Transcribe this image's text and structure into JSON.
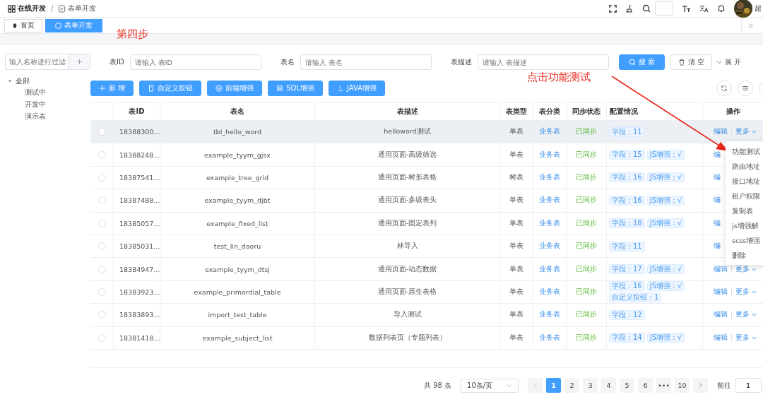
{
  "breadcrumb": [
    {
      "label": "在线开发"
    },
    {
      "label": "表单开发"
    }
  ],
  "breadcrumb_separator": "/",
  "header": {
    "user_name": "超"
  },
  "tabs": [
    {
      "label": "首页",
      "selected": false
    },
    {
      "label": "表单开发",
      "selected": true
    }
  ],
  "annotations": [
    {
      "text": "第四步"
    },
    {
      "text": "点击功能测试"
    }
  ],
  "sidebar": {
    "filter_placeholder": "输入名称进行过滤",
    "tree": [
      {
        "label": "全部",
        "expanded": true,
        "children": [
          {
            "label": "测试中"
          },
          {
            "label": "开发中"
          },
          {
            "label": "演示表"
          }
        ]
      }
    ]
  },
  "search": {
    "fields": [
      {
        "label": "表ID",
        "placeholder": "请输入 表ID"
      },
      {
        "label": "表名",
        "placeholder": "请输入 表名"
      },
      {
        "label": "表描述",
        "placeholder": "请输入 表描述"
      }
    ],
    "search_button": "搜 索",
    "clear_button": "清 空",
    "expand_link": "展 开"
  },
  "toolbar": [
    {
      "kind": "plus",
      "label": "新 增"
    },
    {
      "kind": "custom",
      "label": "自定义按钮"
    },
    {
      "kind": "frontend",
      "label": "前端增强"
    },
    {
      "kind": "sql",
      "label": "SQL增强"
    },
    {
      "kind": "java",
      "label": "JAVA增强"
    }
  ],
  "table": {
    "columns": [
      "表ID",
      "表名",
      "表描述",
      "表类型",
      "表分类",
      "同步状态",
      "配置情况",
      "操作"
    ],
    "rows": [
      {
        "highlighted": true,
        "checked": false,
        "id": "18388300...",
        "name": "tbl_hello_word",
        "desc": "helloword测试",
        "type": "单表",
        "category": "业务表",
        "sync": "已同步",
        "config": [
          "字段：11"
        ],
        "edit": "编辑",
        "more": "更多"
      },
      {
        "highlighted": false,
        "checked": false,
        "id": "18388248...",
        "name": "example_tyym_gjsx",
        "desc": "通用页面-高级筛选",
        "type": "单表",
        "category": "业务表",
        "sync": "已同步",
        "config": [
          "字段：15",
          "JS增强：√"
        ],
        "edit": "编"
      },
      {
        "highlighted": false,
        "checked": false,
        "id": "18387541...",
        "name": "example_tree_grid",
        "desc": "通用页面-树形表格",
        "type": "树表",
        "category": "业务表",
        "sync": "已同步",
        "config": [
          "字段：16",
          "JS增强：√"
        ],
        "edit": "编"
      },
      {
        "highlighted": false,
        "checked": false,
        "id": "18387488...",
        "name": "example_tyym_djbt",
        "desc": "通用页面-多级表头",
        "type": "单表",
        "category": "业务表",
        "sync": "已同步",
        "config": [
          "字段：16",
          "JS增强：√"
        ],
        "edit": "编"
      },
      {
        "highlighted": false,
        "checked": false,
        "id": "18385057...",
        "name": "example_fixed_list",
        "desc": "通用页面-固定表列",
        "type": "单表",
        "category": "业务表",
        "sync": "已同步",
        "config": [
          "字段：18",
          "JS增强：√"
        ],
        "edit": "编"
      },
      {
        "highlighted": false,
        "checked": false,
        "id": "18385031...",
        "name": "test_lin_daoru",
        "desc": "林导入",
        "type": "单表",
        "category": "业务表",
        "sync": "已同步",
        "config": [
          "字段：11"
        ],
        "edit": "编"
      },
      {
        "highlighted": false,
        "checked": false,
        "id": "18384947...",
        "name": "example_tyym_dtsj",
        "desc": "通用页面-动态数据",
        "type": "单表",
        "category": "业务表",
        "sync": "已同步",
        "config": [
          "字段：17",
          "JS增强：√"
        ],
        "edit": "编辑",
        "more": "更多"
      },
      {
        "highlighted": false,
        "checked": false,
        "id": "18383923...",
        "name": "example_primordial_table",
        "desc": "通用页面-原生表格",
        "type": "单表",
        "category": "业务表",
        "sync": "已同步",
        "config": [
          "字段：16",
          "JS增强：√",
          "自定义按钮：1"
        ],
        "edit": "编辑",
        "more": "更多"
      },
      {
        "highlighted": false,
        "checked": false,
        "id": "18383893...",
        "name": "import_test_table",
        "desc": "导入测试",
        "type": "单表",
        "category": "业务表",
        "sync": "已同步",
        "config": [
          "字段：12"
        ],
        "edit": "编辑",
        "more": "更多"
      },
      {
        "highlighted": false,
        "checked": false,
        "id": "18381418...",
        "name": "example_subject_list",
        "desc": "数据列表页（专题列表）",
        "type": "单表",
        "category": "业务表",
        "sync": "已同步",
        "config": [
          "字段：14",
          "JS增强：√"
        ],
        "edit": "编辑",
        "more": "更多"
      }
    ]
  },
  "dropdown_menu": [
    "功能测试",
    "路由地址",
    "接口地址",
    "租户权限",
    "复制表",
    "js增强解",
    "scss增强",
    "删除"
  ],
  "pagination": {
    "total": "共 98 条",
    "page_size": "10条/页",
    "pages": [
      {
        "label": "1",
        "selected": true
      },
      {
        "label": "2",
        "selected": false
      },
      {
        "label": "3",
        "selected": false
      },
      {
        "label": "4",
        "selected": false
      },
      {
        "label": "5",
        "selected": false
      },
      {
        "label": "6",
        "selected": false
      },
      {
        "label": "•••",
        "selected": false
      },
      {
        "label": "10",
        "selected": false
      }
    ],
    "goto_label": "前往",
    "goto_value": "1"
  }
}
